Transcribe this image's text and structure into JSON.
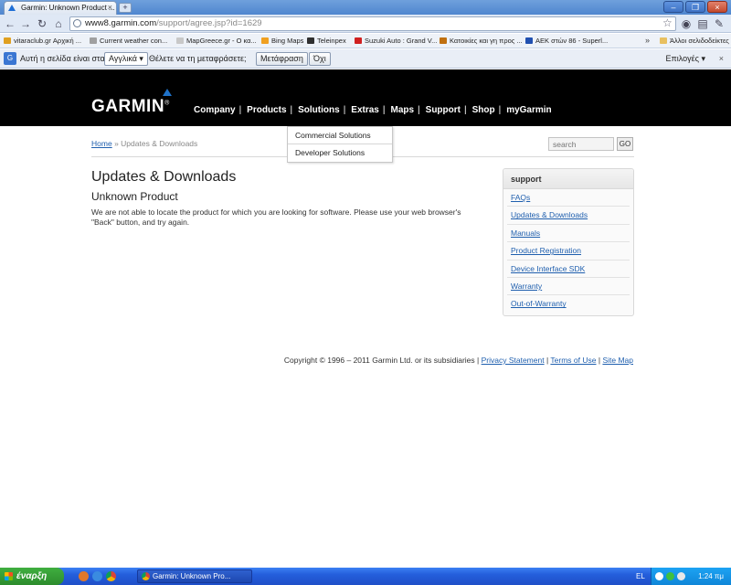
{
  "browser": {
    "tab_title": "Garmin: Unknown Product ...",
    "url_host": "www8.garmin.com",
    "url_path": "/support/agree.jsp?id=1629",
    "bookmarks": [
      {
        "label": "vitaraclub.gr Αρχική ...",
        "color": "#e0a020"
      },
      {
        "label": "Current weather con...",
        "color": "#a0a0a0"
      },
      {
        "label": "MapGreece.gr - Ο κα...",
        "color": "#c8c8c8"
      },
      {
        "label": "Bing Maps",
        "color": "#f0a020"
      },
      {
        "label": "Teleinpex",
        "color": "#303030"
      },
      {
        "label": "Suzuki Auto : Grand V...",
        "color": "#d02020"
      },
      {
        "label": "Κατοικίες και γη προς ...",
        "color": "#c07010"
      },
      {
        "label": "ΑΕΚ στών 86 - Superl...",
        "color": "#2050b0"
      }
    ],
    "bookmarks_more": "»",
    "other_bookmarks": "Άλλοι σελιδοδείκτες"
  },
  "translate_bar": {
    "text_before": "Αυτή η σελίδα είναι στα",
    "language": "Αγγλικά ▾",
    "text_after": "Θέλετε να τη μεταφράσετε;",
    "translate_button": "Μετάφραση",
    "no_button": "Όχι",
    "options": "Επιλογές ▾",
    "close": "×"
  },
  "site": {
    "logo": "GARMIN",
    "logo_reg": "®",
    "nav": [
      "Company",
      "Products",
      "Solutions",
      "Extras",
      "Maps",
      "Support",
      "Shop",
      "myGarmin"
    ],
    "nav_sep": "|",
    "solutions_menu": [
      "Commercial Solutions",
      "Developer Solutions"
    ],
    "breadcrumb": {
      "home": "Home",
      "sep": "»",
      "current": "Updates & Downloads"
    },
    "search": {
      "placeholder": "search",
      "button": "GO"
    },
    "page_title": "Updates & Downloads",
    "subtitle": "Unknown Product",
    "message": "We are not able to locate the product for which you are looking for software. Please use your web browser's \"Back\" button, and try again.",
    "sidebar": {
      "title": "support",
      "links": [
        "FAQs",
        "Updates & Downloads",
        "Manuals",
        "Product Registration",
        "Device Interface SDK",
        "Warranty",
        "Out-of-Warranty"
      ]
    },
    "footer": {
      "copyright": "Copyright © 1996 – 2011 Garmin Ltd. or its subsidiaries |",
      "links": [
        "Privacy Statement",
        "Terms of Use",
        "Site Map"
      ],
      "sep": "|"
    }
  },
  "taskbar": {
    "start": "έναρξη",
    "task": "Garmin: Unknown Pro...",
    "lang": "EL",
    "clock": "1:24 πμ"
  }
}
